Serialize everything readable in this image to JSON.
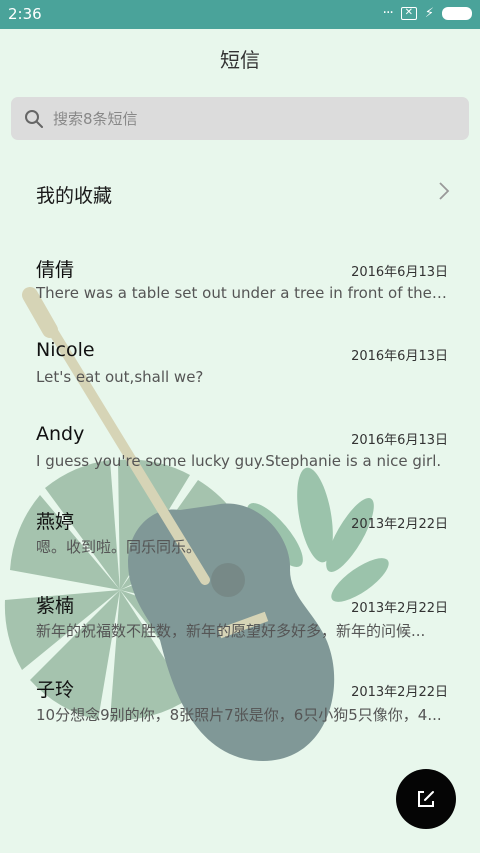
{
  "status": {
    "time": "2:36",
    "icons": [
      "more-dots-icon",
      "sim-x-icon",
      "charging-bolt-icon",
      "battery-icon"
    ]
  },
  "header": {
    "title": "短信"
  },
  "search": {
    "placeholder": "搜索8条短信"
  },
  "favorites": {
    "label": "我的收藏"
  },
  "conversations": [
    {
      "name": "倩倩",
      "date": "2016年6月13日",
      "preview": "There was a table set out under a tree in front of the h..."
    },
    {
      "name": "Nicole",
      "date": "2016年6月13日",
      "preview": "Let's eat out,shall we?"
    },
    {
      "name": "Andy",
      "date": "2016年6月13日",
      "preview": "I guess you're some lucky guy.Stephanie is a nice girl."
    },
    {
      "name": "燕婷",
      "date": "2013年2月22日",
      "preview": "嗯。收到啦。同乐同乐。"
    },
    {
      "name": "紫楠",
      "date": "2013年2月22日",
      "preview": "新年的祝福数不胜数，新年的愿望好多好多，新年的问候..."
    },
    {
      "name": "子玲",
      "date": "2013年2月22日",
      "preview": "10分想念9别的你，8张照片7张是你，6只小狗5只像你，4..."
    }
  ],
  "fab": {
    "icon": "compose-icon"
  },
  "colors": {
    "status_bar": "#4aa39a",
    "background": "#e8f7ec",
    "fab": "#050505"
  }
}
